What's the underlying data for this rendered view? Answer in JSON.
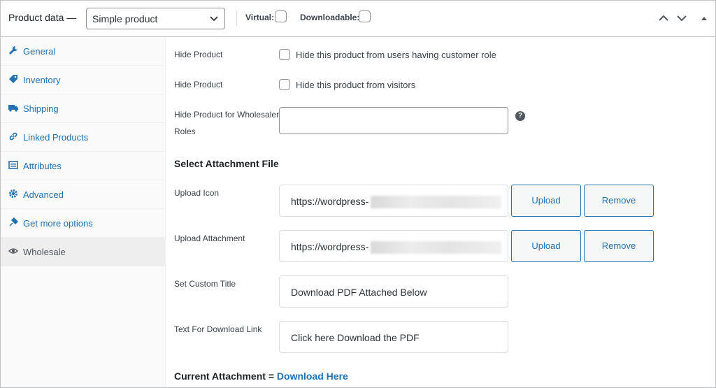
{
  "header": {
    "title": "Product data —",
    "product_type": "Simple product",
    "virtual_label": "Virtual:",
    "downloadable_label": "Downloadable:",
    "virtual_checked": false,
    "downloadable_checked": false
  },
  "sidebar": {
    "items": [
      {
        "label": "General",
        "icon": "wrench-icon"
      },
      {
        "label": "Inventory",
        "icon": "tag-icon"
      },
      {
        "label": "Shipping",
        "icon": "truck-icon"
      },
      {
        "label": "Linked Products",
        "icon": "link-icon"
      },
      {
        "label": "Attributes",
        "icon": "list-icon"
      },
      {
        "label": "Advanced",
        "icon": "gear-icon"
      },
      {
        "label": "Get more options",
        "icon": "plugin-icon"
      },
      {
        "label": "Wholesale",
        "icon": "visibility-icon",
        "active": true
      }
    ]
  },
  "form": {
    "hide_customer": {
      "label": "Hide Product",
      "text": "Hide this product from users having customer role",
      "checked": false
    },
    "hide_visitors": {
      "label": "Hide Product",
      "text": "Hide this product from visitors",
      "checked": false
    },
    "wholesaler_roles": {
      "label_line1": "Hide Product for Wholesaler",
      "label_line2": "Roles",
      "value": "",
      "help": "?"
    },
    "section_title": "Select Attachment File",
    "upload_icon": {
      "label": "Upload Icon",
      "value": "https://wordpress-",
      "upload": "Upload",
      "remove": "Remove"
    },
    "upload_attachment": {
      "label": "Upload Attachment",
      "value": "https://wordpress-",
      "upload": "Upload",
      "remove": "Remove"
    },
    "custom_title": {
      "label": "Set Custom Title",
      "value": "Download PDF Attached Below"
    },
    "download_link_text": {
      "label": "Text For Download Link",
      "value": "Click here Download the PDF"
    },
    "current_attachment": {
      "label": "Current Attachment =",
      "link": "Download Here"
    }
  },
  "colors": {
    "accent": "#2271b1",
    "border": "#c3c4c7",
    "sidebar_bg": "#fafafa",
    "active_tab": "#eeeeee"
  }
}
